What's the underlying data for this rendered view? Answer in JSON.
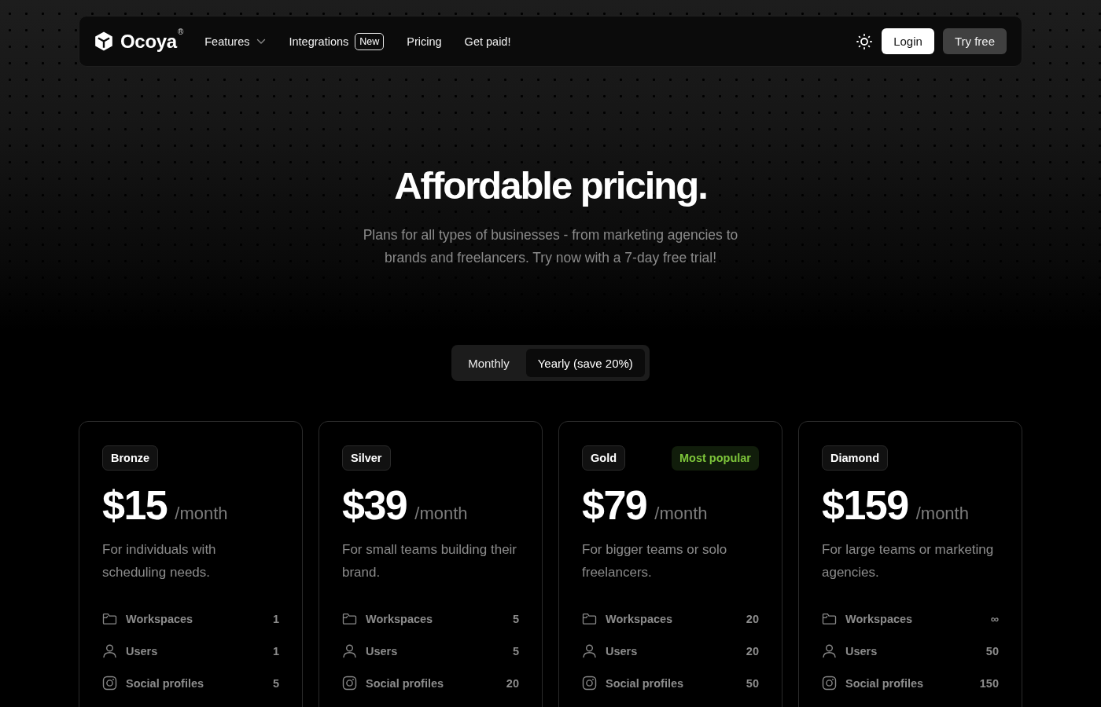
{
  "nav": {
    "brand": "Ocoya",
    "brand_mark": "®",
    "links": [
      {
        "label": "Features",
        "kind": "dropdown"
      },
      {
        "label": "Integrations",
        "kind": "badged",
        "badge": "New"
      },
      {
        "label": "Pricing",
        "kind": "plain"
      },
      {
        "label": "Get paid!",
        "kind": "plain"
      }
    ],
    "buttons": [
      {
        "label": "Login",
        "kind": "login"
      },
      {
        "label": "Try free",
        "kind": "trial"
      }
    ]
  },
  "hero": {
    "title": "Affordable pricing.",
    "subtitle": "Plans for all types of businesses - from marketing agencies to brands and freelancers. Try now with a 7-day free trial!"
  },
  "billing_toggle": [
    {
      "label": "Monthly",
      "selected": false
    },
    {
      "label": "Yearly (save 20%)",
      "selected": true
    }
  ],
  "plans": [
    {
      "name": "Bronze",
      "price": "$15",
      "period": "/month",
      "description": "For individuals with scheduling needs.",
      "features": [
        {
          "kind": "workspaces",
          "label": "Workspaces",
          "value": "1"
        },
        {
          "kind": "users",
          "label": "Users",
          "value": "1"
        },
        {
          "kind": "profiles",
          "label": "Social profiles",
          "value": "5"
        }
      ]
    },
    {
      "name": "Silver",
      "price": "$39",
      "period": "/month",
      "description": "For small teams building their brand.",
      "features": [
        {
          "kind": "workspaces",
          "label": "Workspaces",
          "value": "5"
        },
        {
          "kind": "users",
          "label": "Users",
          "value": "5"
        },
        {
          "kind": "profiles",
          "label": "Social profiles",
          "value": "20"
        }
      ]
    },
    {
      "name": "Gold",
      "highlight": "Most popular",
      "price": "$79",
      "period": "/month",
      "description": "For bigger teams or solo freelancers.",
      "features": [
        {
          "kind": "workspaces",
          "label": "Workspaces",
          "value": "20"
        },
        {
          "kind": "users",
          "label": "Users",
          "value": "20"
        },
        {
          "kind": "profiles",
          "label": "Social profiles",
          "value": "50"
        }
      ]
    },
    {
      "name": "Diamond",
      "price": "$159",
      "period": "/month",
      "description": "For large teams or marketing agencies.",
      "features": [
        {
          "kind": "workspaces",
          "label": "Workspaces",
          "value": "∞"
        },
        {
          "kind": "users",
          "label": "Users",
          "value": "50"
        },
        {
          "kind": "profiles",
          "label": "Social profiles",
          "value": "150"
        }
      ]
    }
  ]
}
